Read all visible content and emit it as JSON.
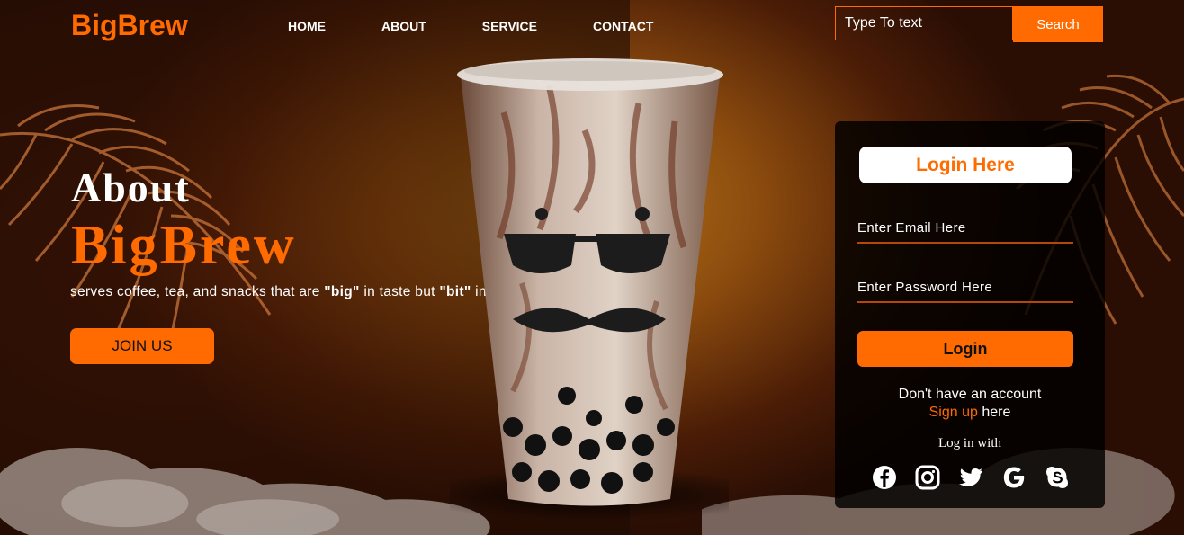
{
  "header": {
    "logo": "BigBrew",
    "nav": [
      "HOME",
      "ABOUT",
      "SERVICE",
      "CONTACT"
    ],
    "search": {
      "placeholder": "Type To text",
      "button": "Search"
    }
  },
  "hero": {
    "title_line1": "About",
    "title_line2": "BigBrew",
    "tagline_pre": "serves coffee, tea, and snacks that are ",
    "tagline_big": "\"big\"",
    "tagline_mid": " in taste but ",
    "tagline_bit": "\"bit\"",
    "tagline_post": " in price.",
    "cta": "JOIN US"
  },
  "login": {
    "title": "Login Here",
    "email_placeholder": "Enter Email Here",
    "password_placeholder": "Enter Password Here",
    "button": "Login",
    "no_account": "Don't have an account",
    "signup_link": "Sign up",
    "signup_suffix": " here",
    "login_with": "Log in with",
    "socials": [
      "facebook-icon",
      "instagram-icon",
      "twitter-icon",
      "google-icon",
      "skype-icon"
    ]
  },
  "colors": {
    "accent": "#ff6b00",
    "panel": "#000000"
  }
}
